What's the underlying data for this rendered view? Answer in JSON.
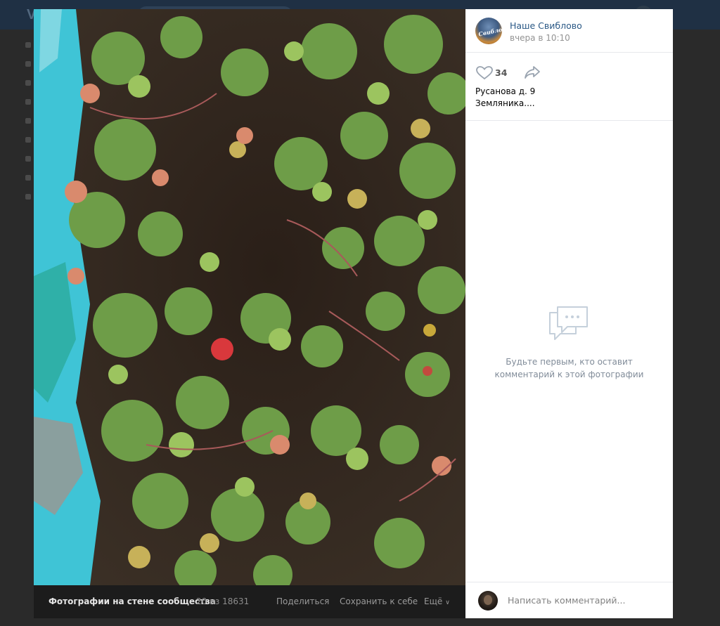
{
  "viewer": {
    "author": "Наше Свиблово",
    "time": "вчера в 10:10",
    "likes": "34",
    "description_line1": "Русанова д. 9",
    "description_line2": "Земляника....",
    "empty_comments_line1": "Будьте первым, кто оставит",
    "empty_comments_line2": "комментарий к этой фотографии",
    "comment_placeholder": "Написать комментарий...",
    "avatar_text": "Свиблово"
  },
  "photo_bar": {
    "album_title": "Фотографии на стене сообщества",
    "counter": "20 из 18631",
    "share_label": "Поделиться",
    "save_label": "Сохранить к себе",
    "more_label": "Ещё"
  },
  "background": {
    "logo": "VK"
  },
  "colors": {
    "link": "#2a5885",
    "muted": "#939393",
    "overlay": "#2b2b2b",
    "photo_bar": "#1c1c1c",
    "strawberry": "#d9383c"
  }
}
